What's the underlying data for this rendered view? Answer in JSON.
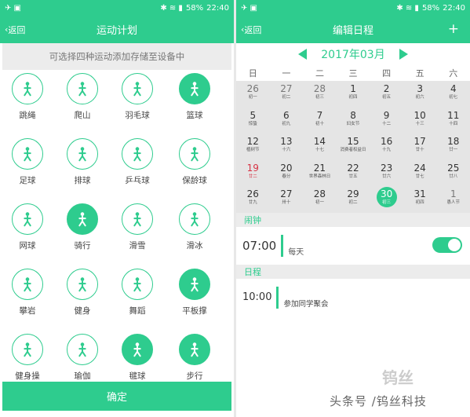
{
  "status_left": {
    "battery": "58%",
    "time": "22:40"
  },
  "status_right": {
    "battery": "58%",
    "time": "22:40"
  },
  "left": {
    "back": "返回",
    "title": "运动计划",
    "hint": "可选择四种运动添加存储至设备中",
    "sports": [
      {
        "label": "跳绳",
        "icon": "jump-rope-icon",
        "selected": false
      },
      {
        "label": "爬山",
        "icon": "hiking-icon",
        "selected": false
      },
      {
        "label": "羽毛球",
        "icon": "badminton-icon",
        "selected": false
      },
      {
        "label": "篮球",
        "icon": "basketball-icon",
        "selected": true
      },
      {
        "label": "足球",
        "icon": "football-icon",
        "selected": false
      },
      {
        "label": "排球",
        "icon": "volleyball-icon",
        "selected": false
      },
      {
        "label": "乒乓球",
        "icon": "ping-pong-icon",
        "selected": false
      },
      {
        "label": "保龄球",
        "icon": "bowling-icon",
        "selected": false
      },
      {
        "label": "网球",
        "icon": "tennis-icon",
        "selected": false
      },
      {
        "label": "骑行",
        "icon": "cycling-icon",
        "selected": true
      },
      {
        "label": "滑雪",
        "icon": "skiing-icon",
        "selected": false
      },
      {
        "label": "滑冰",
        "icon": "skating-icon",
        "selected": false
      },
      {
        "label": "攀岩",
        "icon": "climbing-icon",
        "selected": false
      },
      {
        "label": "健身",
        "icon": "treadmill-icon",
        "selected": false
      },
      {
        "label": "舞蹈",
        "icon": "dance-icon",
        "selected": false
      },
      {
        "label": "平板撑",
        "icon": "plank-icon",
        "selected": true
      },
      {
        "label": "健身操",
        "icon": "aerobics-icon",
        "selected": false
      },
      {
        "label": "瑜伽",
        "icon": "yoga-icon",
        "selected": false
      },
      {
        "label": "毽球",
        "icon": "shuttlecock-icon",
        "selected": true
      },
      {
        "label": "步行",
        "icon": "walking-icon",
        "selected": true
      }
    ],
    "confirm": "确定"
  },
  "right": {
    "back": "返回",
    "title": "编辑日程",
    "add": "+",
    "month": "2017年03月",
    "weekdays": [
      "日",
      "一",
      "二",
      "三",
      "四",
      "五",
      "六"
    ],
    "weeks": [
      [
        {
          "n": "26",
          "s": "初一",
          "dim": true
        },
        {
          "n": "27",
          "s": "初二",
          "dim": true
        },
        {
          "n": "28",
          "s": "初三",
          "dim": true
        },
        {
          "n": "1",
          "s": "初四"
        },
        {
          "n": "2",
          "s": "初五"
        },
        {
          "n": "3",
          "s": "初六"
        },
        {
          "n": "4",
          "s": "初七"
        }
      ],
      [
        {
          "n": "5",
          "s": "惊蛰"
        },
        {
          "n": "6",
          "s": "初九"
        },
        {
          "n": "7",
          "s": "初十"
        },
        {
          "n": "8",
          "s": "妇女节"
        },
        {
          "n": "9",
          "s": "十二"
        },
        {
          "n": "10",
          "s": "十三"
        },
        {
          "n": "11",
          "s": "十四"
        }
      ],
      [
        {
          "n": "12",
          "s": "植树节"
        },
        {
          "n": "13",
          "s": "十六"
        },
        {
          "n": "14",
          "s": "十七"
        },
        {
          "n": "15",
          "s": "消费者权益日"
        },
        {
          "n": "16",
          "s": "十九"
        },
        {
          "n": "17",
          "s": "廿十"
        },
        {
          "n": "18",
          "s": "廿一"
        }
      ],
      [
        {
          "n": "19",
          "s": "廿二",
          "red": true
        },
        {
          "n": "20",
          "s": "春分"
        },
        {
          "n": "21",
          "s": "世界森林日"
        },
        {
          "n": "22",
          "s": "廿五"
        },
        {
          "n": "23",
          "s": "廿六"
        },
        {
          "n": "24",
          "s": "廿七"
        },
        {
          "n": "25",
          "s": "廿八"
        }
      ],
      [
        {
          "n": "26",
          "s": "廿九"
        },
        {
          "n": "27",
          "s": "卅十"
        },
        {
          "n": "28",
          "s": "初一"
        },
        {
          "n": "29",
          "s": "初二"
        },
        {
          "n": "30",
          "s": "初三",
          "today": true
        },
        {
          "n": "31",
          "s": "初四"
        },
        {
          "n": "1",
          "s": "愚人节",
          "dim": true
        }
      ]
    ],
    "alarm_section": "闹钟",
    "alarm_time": "07:00",
    "alarm_repeat": "每天",
    "alarm_on": true,
    "schedule_section": "日程",
    "event_time": "10:00",
    "event_text": "参加同学聚会"
  },
  "watermark": "头条号 /钨丝科技",
  "watermark_logo": "钨丝",
  "colors": {
    "accent": "#2ecc8e",
    "holiday": "#d63344"
  }
}
